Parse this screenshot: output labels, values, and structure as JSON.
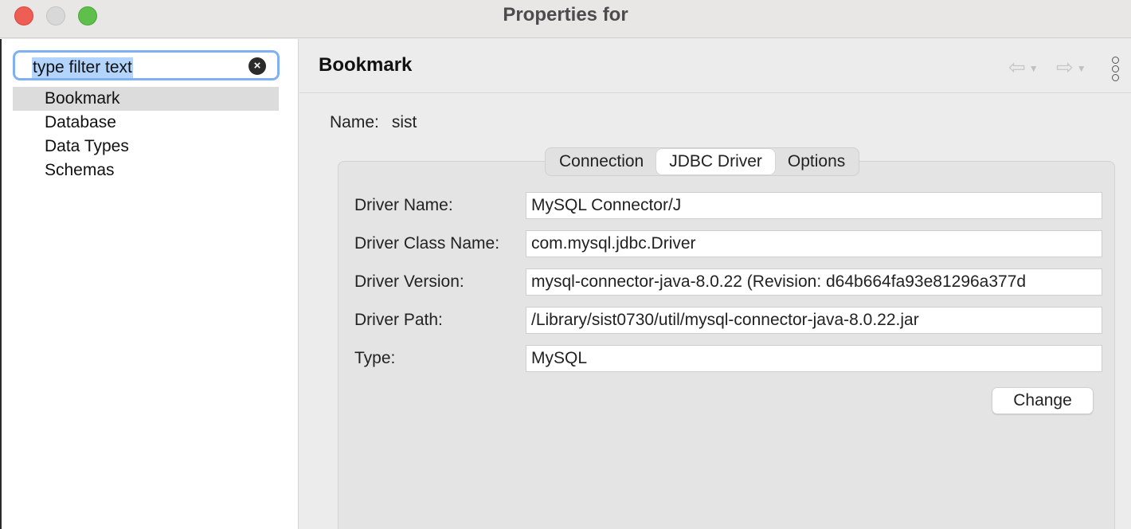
{
  "window": {
    "title": "Properties for"
  },
  "sidebar": {
    "filter": {
      "value": "type filter text"
    },
    "items": [
      {
        "label": "Bookmark",
        "selected": true
      },
      {
        "label": "Database",
        "selected": false
      },
      {
        "label": "Data Types",
        "selected": false
      },
      {
        "label": "Schemas",
        "selected": false
      }
    ]
  },
  "main": {
    "title": "Bookmark",
    "name_label": "Name:",
    "name_value": "sist",
    "tabs": [
      {
        "label": "Connection",
        "active": false
      },
      {
        "label": "JDBC Driver",
        "active": true
      },
      {
        "label": "Options",
        "active": false
      }
    ],
    "fields": [
      {
        "label": "Driver Name:",
        "value": "MySQL Connector/J"
      },
      {
        "label": "Driver Class Name:",
        "value": "com.mysql.jdbc.Driver"
      },
      {
        "label": "Driver Version:",
        "value": "mysql-connector-java-8.0.22 (Revision: d64b664fa93e81296a377d"
      },
      {
        "label": "Driver Path:",
        "value": "/Library/sist0730/util/mysql-connector-java-8.0.22.jar"
      },
      {
        "label": "Type:",
        "value": "MySQL"
      }
    ],
    "change_label": "Change"
  },
  "icons": {
    "close": "close-window-icon",
    "minimize": "minimize-window-icon",
    "maximize": "maximize-window-icon",
    "clear": "clear-search-icon",
    "back": "back-arrow-icon",
    "forward": "forward-arrow-icon",
    "menu": "more-options-icon"
  },
  "colors": {
    "close": "#ee5e55",
    "maximize": "#5ec04a",
    "focus_ring": "#7fb0f2",
    "selection": "#b3d4fc"
  }
}
